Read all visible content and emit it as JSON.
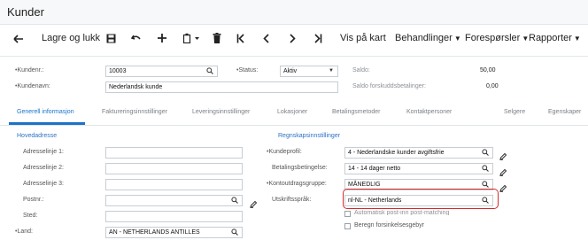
{
  "window": {
    "title": "Kunder"
  },
  "toolbar": {
    "save_close_label": "Lagre og lukk",
    "view_map_label": "Vis på kart",
    "actions_label": "Behandlinger",
    "inquiries_label": "Forespørsler",
    "reports_label": "Rapporter"
  },
  "summary": {
    "customer_no_label": "Kundenr.:",
    "customer_no_value": "10003",
    "status_label": "Status:",
    "status_value": "Aktiv",
    "customer_name_label": "Kundenavn:",
    "customer_name_value": "Nederlandsk kunde",
    "balance_label": "Saldo:",
    "balance_value": "50,00",
    "prepayment_balance_label": "Saldo forskuddsbetalinger:",
    "prepayment_balance_value": "0,00"
  },
  "tabs": [
    {
      "label": "Generell informasjon",
      "active": true
    },
    {
      "label": "Faktureringsinnstillinger",
      "active": false
    },
    {
      "label": "Leveringsinnstillinger",
      "active": false
    },
    {
      "label": "Lokasjoner",
      "active": false
    },
    {
      "label": "Betalingsmetoder",
      "active": false
    },
    {
      "label": "Kontaktpersoner",
      "active": false
    },
    {
      "label": "Selgere",
      "active": false
    },
    {
      "label": "Egenskaper",
      "active": false
    }
  ],
  "main_address": {
    "heading": "Hovedadresse",
    "address1_label": "Adresselinje 1:",
    "address1_value": "",
    "address2_label": "Adresselinje 2:",
    "address2_value": "",
    "address3_label": "Adresselinje 3:",
    "address3_value": "",
    "postcode_label": "Postnr.:",
    "postcode_value": "",
    "city_label": "Sted:",
    "city_value": "",
    "country_label": "Land:",
    "country_value": "AN - NETHERLANDS ANTILLES"
  },
  "accounting": {
    "heading": "Regnskapsinnstillinger",
    "customer_profile_label": "Kundeprofil:",
    "customer_profile_value": "4 - Nederlandske kunder avgiftsfrie",
    "payment_terms_label": "Betalingsbetingelse:",
    "payment_terms_value": "14 - 14 dager netto",
    "statement_group_label": "Kontoutdragsgruppe:",
    "statement_group_value": "MÅNEDLIG",
    "print_language_label": "Utskriftsspråk:",
    "print_language_value": "nl-NL - Netherlands",
    "auto_post_label": "Automatisk post-inn post-matching",
    "calc_fee_label": "Beregn forsinkelsesgebyr"
  },
  "colors": {
    "accent": "#1a73c9",
    "highlight": "#d42a2a"
  }
}
